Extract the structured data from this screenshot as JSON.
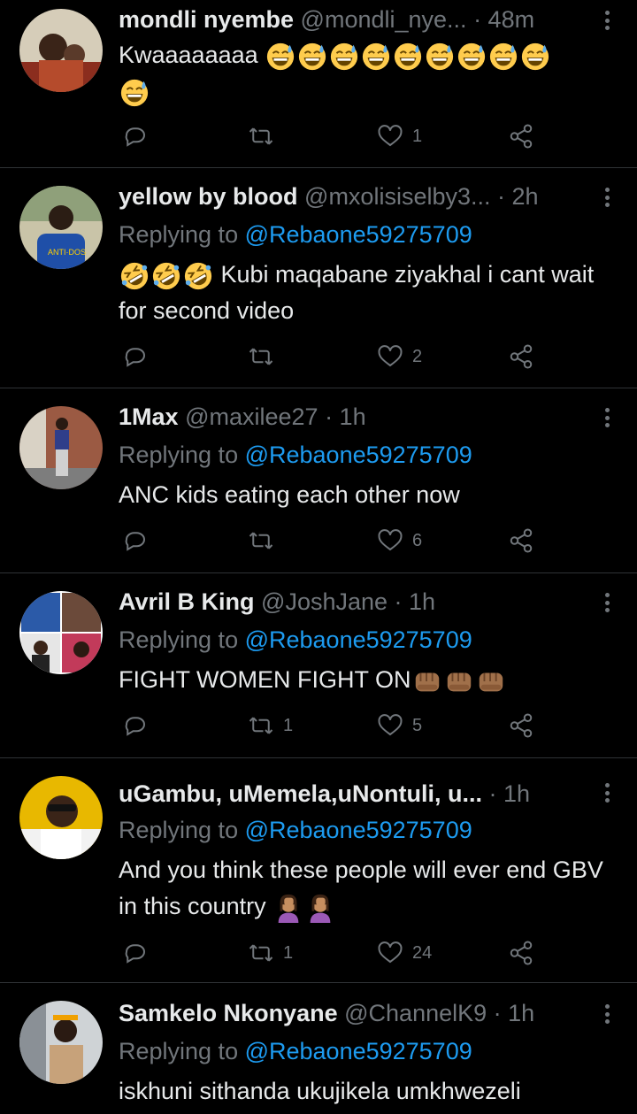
{
  "tweets": [
    {
      "name": "mondli nyembe",
      "handle": "@mondli_nye...",
      "time": "· 48m",
      "replying_prefix": "",
      "replying_to": "",
      "text": "Kwaaaaaaaa",
      "emojis": [
        "sweat-smile",
        "sweat-smile",
        "sweat-smile",
        "sweat-smile",
        "sweat-smile",
        "sweat-smile",
        "sweat-smile",
        "sweat-smile",
        "sweat-smile",
        "sweat-smile"
      ],
      "retweets": "",
      "likes": "1"
    },
    {
      "name": "yellow by blood",
      "handle": "@mxolisiselby3...",
      "time": "· 2h",
      "replying_prefix": "Replying to ",
      "replying_to": "@Rebaone59275709",
      "text": "Kubi maqabane ziyakhal i cant wait for second video",
      "emojis_lead": [
        "rofl",
        "rofl",
        "rofl"
      ],
      "retweets": "",
      "likes": "2"
    },
    {
      "name": "1Max",
      "handle": "@maxilee27",
      "time": "· 1h",
      "replying_prefix": "Replying to ",
      "replying_to": "@Rebaone59275709",
      "text": "ANC kids eating each other now",
      "retweets": "",
      "likes": "6"
    },
    {
      "name": "Avril B King",
      "handle": "@JoshJane",
      "time": "· 1h",
      "replying_prefix": "Replying to ",
      "replying_to": "@Rebaone59275709",
      "text": "FIGHT WOMEN FIGHT ON",
      "emojis": [
        "fist",
        "fist",
        "fist"
      ],
      "retweets": "1",
      "likes": "5"
    },
    {
      "name": "uGambu, uMemela,uNontuli, u...",
      "handle": "",
      "time": "· 1h",
      "replying_prefix": "Replying to ",
      "replying_to": "@Rebaone59275709",
      "text": "And you think these people will ever end GBV in this country",
      "emojis": [
        "facepalm",
        "facepalm"
      ],
      "retweets": "1",
      "likes": "24"
    },
    {
      "name": "Samkelo Nkonyane",
      "handle": "@ChannelK9",
      "time": "· 1h",
      "replying_prefix": "Replying to ",
      "replying_to": "@Rebaone59275709",
      "text": "iskhuni sithanda ukujikela umkhwezeli",
      "retweets": "",
      "likes": ""
    }
  ],
  "colors": {
    "background": "#000000",
    "text": "#e7e9ea",
    "muted": "#71767b",
    "mention": "#1d9bf0",
    "divider": "#2f3336"
  }
}
